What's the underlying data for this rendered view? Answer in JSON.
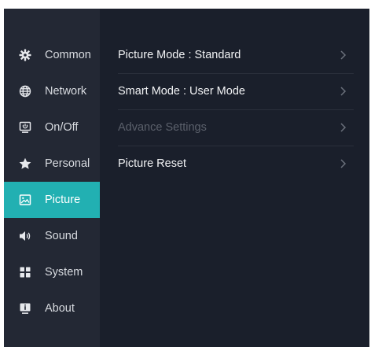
{
  "sidebar": {
    "items": [
      {
        "label": "Common",
        "icon": "gear-icon",
        "active": false
      },
      {
        "label": "Network",
        "icon": "globe-icon",
        "active": false
      },
      {
        "label": "On/Off",
        "icon": "monitor-power-icon",
        "active": false
      },
      {
        "label": "Personal",
        "icon": "star-icon",
        "active": false
      },
      {
        "label": "Picture",
        "icon": "picture-icon",
        "active": true
      },
      {
        "label": "Sound",
        "icon": "speaker-icon",
        "active": false
      },
      {
        "label": "System",
        "icon": "grid-icon",
        "active": false
      },
      {
        "label": "About",
        "icon": "info-monitor-icon",
        "active": false
      }
    ]
  },
  "picture_menu": {
    "picture_mode": {
      "label": "Picture Mode :",
      "value": "Standard"
    },
    "smart_mode": {
      "label": "Smart Mode :",
      "value": "User Mode"
    },
    "advance_settings": {
      "label": "Advance Settings",
      "enabled": false
    },
    "picture_reset": {
      "label": "Picture Reset"
    }
  },
  "colors": {
    "accent": "#22b0b2",
    "panel_bg": "#1a1f2b",
    "sidebar_bg": "#232834",
    "disabled_text": "#5b606b"
  }
}
